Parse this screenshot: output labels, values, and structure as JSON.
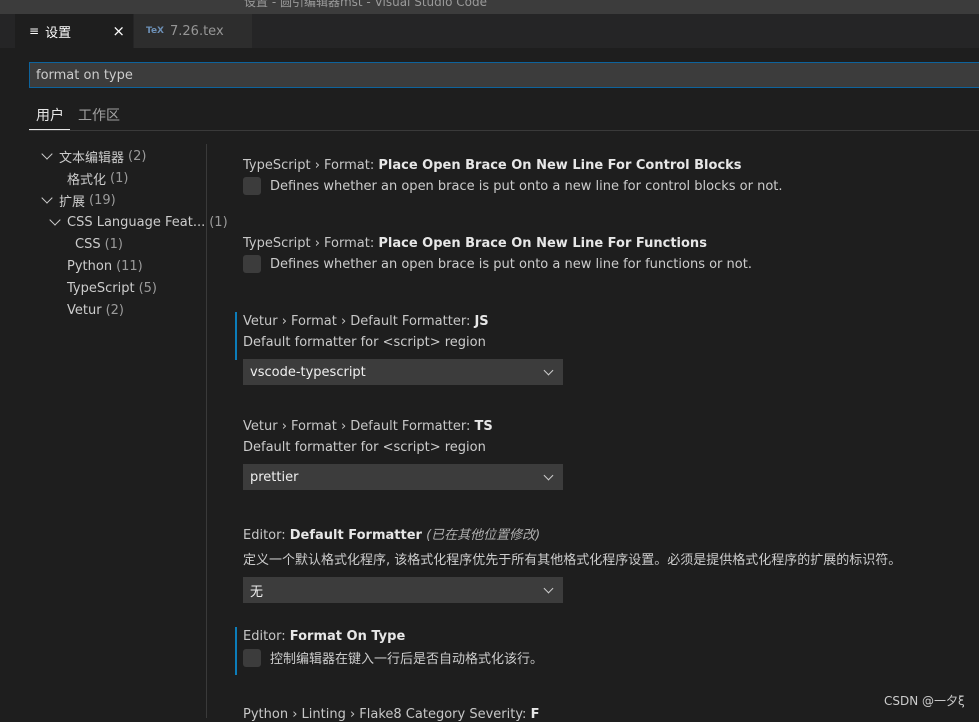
{
  "window": {
    "title": "设置 - 圆引编辑器mst - Visual Studio Code"
  },
  "tabs": [
    {
      "label": "设置",
      "icon": "settings-list-icon",
      "close": "×"
    },
    {
      "label": "7.26.tex",
      "icon": "tex-file-icon",
      "icon_text": "TeX"
    }
  ],
  "search": {
    "value": "format on type"
  },
  "scope_tabs": {
    "user": "用户",
    "workspace": "工作区"
  },
  "toc": {
    "items": [
      {
        "label": "文本编辑器",
        "count": "(2)"
      },
      {
        "label": "格式化",
        "count": "(1)"
      },
      {
        "label": "扩展",
        "count": "(19)"
      },
      {
        "label": "CSS Language Feat...",
        "count": "(1)"
      },
      {
        "label": "CSS",
        "count": "(1)"
      },
      {
        "label": "Python",
        "count": "(11)"
      },
      {
        "label": "TypeScript",
        "count": "(5)"
      },
      {
        "label": "Vetur",
        "count": "(2)"
      }
    ]
  },
  "settings": [
    {
      "category": "TypeScript › Format: ",
      "name": "Place Open Brace On New Line For Control Blocks",
      "description": "Defines whether an open brace is put onto a new line for control blocks or not.",
      "type": "checkbox",
      "checked": false
    },
    {
      "category": "TypeScript › Format: ",
      "name": "Place Open Brace On New Line For Functions",
      "description": "Defines whether an open brace is put onto a new line for functions or not.",
      "type": "checkbox",
      "checked": false
    },
    {
      "category": "Vetur › Format › Default Formatter: ",
      "name": "JS",
      "description": "Default formatter for <script> region",
      "type": "select",
      "value": "vscode-typescript"
    },
    {
      "category": "Vetur › Format › Default Formatter: ",
      "name": "TS",
      "description": "Default formatter for <script> region",
      "type": "select",
      "value": "prettier"
    },
    {
      "category": "Editor: ",
      "name": "Default Formatter",
      "note": "(已在其他位置修改)",
      "description": "定义一个默认格式化程序, 该格式化程序优先于所有其他格式化程序设置。必须是提供格式化程序的扩展的标识符。",
      "type": "select",
      "value": "无"
    },
    {
      "category": "Editor: ",
      "name": "Format On Type",
      "description": "控制编辑器在键入一行后是否自动格式化该行。",
      "type": "checkbox",
      "checked": false
    },
    {
      "category": "Python › Linting › Flake8 Category Severity: ",
      "name": "F"
    }
  ],
  "watermark": "CSDN @一夕ξ"
}
